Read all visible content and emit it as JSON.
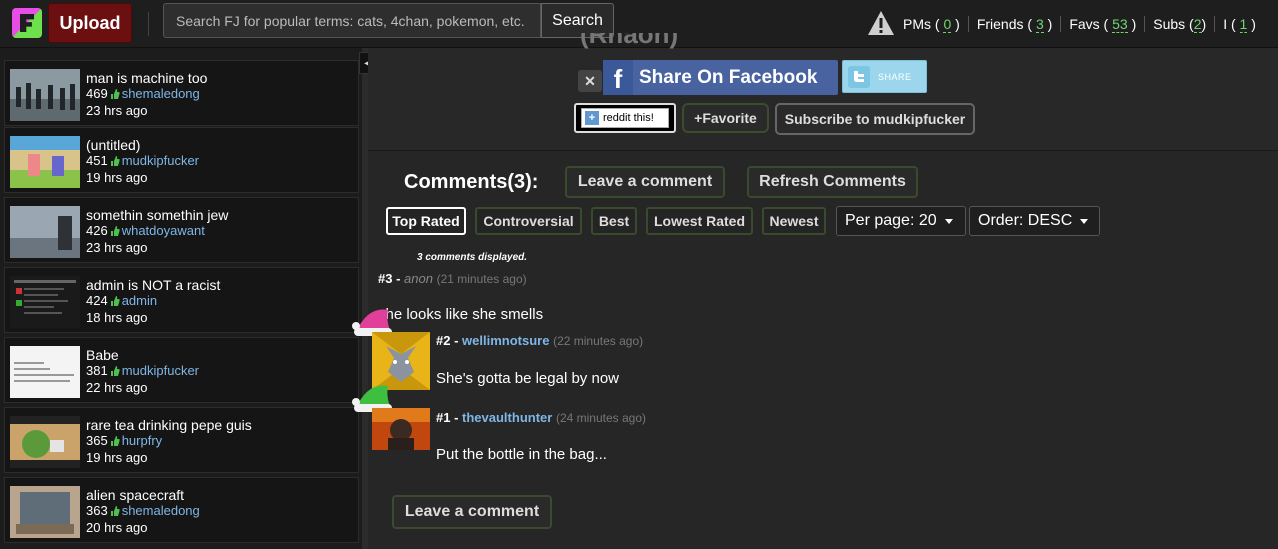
{
  "header": {
    "upload_label": "Upload",
    "search_placeholder": "Search FJ for popular terms: cats, 4chan, pokemon, etc.",
    "search_button": "Search",
    "nav": [
      {
        "label": "PMs",
        "count": "0"
      },
      {
        "label": "Friends",
        "count": "3"
      },
      {
        "label": "Favs",
        "count": "53"
      },
      {
        "label": "Subs",
        "count": "2"
      },
      {
        "label": "I",
        "count": "1"
      }
    ]
  },
  "sidebar": {
    "items": [
      {
        "title": "man is machine too",
        "thumbs": "469",
        "user": "shemaledong",
        "age": "23 hrs ago"
      },
      {
        "title": "(untitled)",
        "thumbs": "451",
        "user": "mudkipfucker",
        "age": "19 hrs ago"
      },
      {
        "title": "somethin somethin jew",
        "thumbs": "426",
        "user": "whatdoyawant",
        "age": "23 hrs ago"
      },
      {
        "title": "admin is NOT a racist",
        "thumbs": "424",
        "user": "admin",
        "age": "18 hrs ago"
      },
      {
        "title": "Babe",
        "thumbs": "381",
        "user": "mudkipfucker",
        "age": "22 hrs ago"
      },
      {
        "title": "rare tea drinking pepe guis",
        "thumbs": "365",
        "user": "hurpfry",
        "age": "19 hrs ago"
      },
      {
        "title": "alien spacecraft",
        "thumbs": "363",
        "user": "shemaledong",
        "age": "20 hrs ago"
      }
    ]
  },
  "share": {
    "cut_title": "(Rnaon)",
    "facebook_label": "Share On Facebook",
    "twitter_label": "SHARE",
    "reddit_label": "reddit this!",
    "favorite_label": "+Favorite",
    "subscribe_label": "Subscribe to mudkipfucker"
  },
  "comments": {
    "title": "Comments(3):",
    "leave_label": "Leave a comment",
    "refresh_label": "Refresh Comments",
    "sort_tabs": [
      "Top Rated",
      "Controversial",
      "Best",
      "Lowest Rated",
      "Newest"
    ],
    "active_sort": "Top Rated",
    "per_page": "Per page: 20",
    "order": "Order: DESC",
    "displayed_text": "3 comments displayed.",
    "list": [
      {
        "num": "#3",
        "author": "anon",
        "time": "(21 minutes ago)",
        "text": "she looks like she smells"
      },
      {
        "num": "#2",
        "author": "wellimnotsure",
        "time": "(22 minutes ago)",
        "text": "She's gotta be legal by now"
      },
      {
        "num": "#1",
        "author": "thevaulthunter",
        "time": "(24 minutes ago)",
        "text": "Put the bottle in the bag..."
      }
    ],
    "leave_bottom_label": "Leave a comment"
  }
}
